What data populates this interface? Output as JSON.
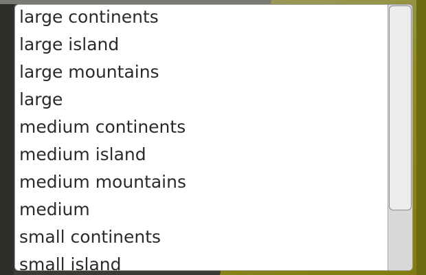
{
  "listbox": {
    "items": [
      "large continents",
      "large island",
      "large mountains",
      "large",
      "medium continents",
      "medium island",
      "medium mountains",
      "medium",
      "small continents",
      "small island"
    ]
  },
  "colors": {
    "background_dark": "#3a3a36",
    "background_olive": "#8f8c22",
    "list_background": "#ffffff",
    "text": "#2a2a2a",
    "scroll_track": "#d8d8d8",
    "scroll_thumb": "#ececec"
  }
}
